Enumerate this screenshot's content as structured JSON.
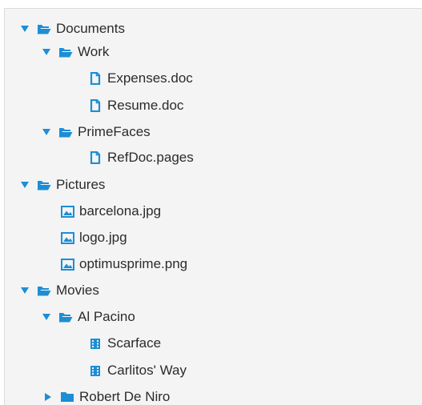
{
  "tree": {
    "documents": {
      "label": "Documents",
      "icon": "folder-open-icon",
      "expanded": true
    },
    "work": {
      "label": "Work",
      "icon": "folder-open-icon",
      "expanded": true
    },
    "expenses": {
      "label": "Expenses.doc",
      "icon": "document-icon"
    },
    "resume": {
      "label": "Resume.doc",
      "icon": "document-icon"
    },
    "primefaces": {
      "label": "PrimeFaces",
      "icon": "folder-open-icon",
      "expanded": true
    },
    "refdoc": {
      "label": "RefDoc.pages",
      "icon": "document-icon"
    },
    "pictures": {
      "label": "Pictures",
      "icon": "folder-open-icon",
      "expanded": true
    },
    "barcelona": {
      "label": "barcelona.jpg",
      "icon": "image-icon"
    },
    "logo": {
      "label": "logo.jpg",
      "icon": "image-icon"
    },
    "optimusprime": {
      "label": "optimusprime.png",
      "icon": "image-icon"
    },
    "movies": {
      "label": "Movies",
      "icon": "folder-open-icon",
      "expanded": true
    },
    "alpacino": {
      "label": "Al Pacino",
      "icon": "folder-open-icon",
      "expanded": true
    },
    "scarface": {
      "label": "Scarface",
      "icon": "film-icon"
    },
    "carlitos": {
      "label": "Carlitos' Way",
      "icon": "film-icon"
    },
    "robertdeniro": {
      "label": "Robert De Niro",
      "icon": "folder-closed-icon",
      "expanded": false
    }
  },
  "colors": {
    "accent": "#1c8ed6",
    "panel_background": "#f4f4f4",
    "text": "#2b2b2b"
  }
}
